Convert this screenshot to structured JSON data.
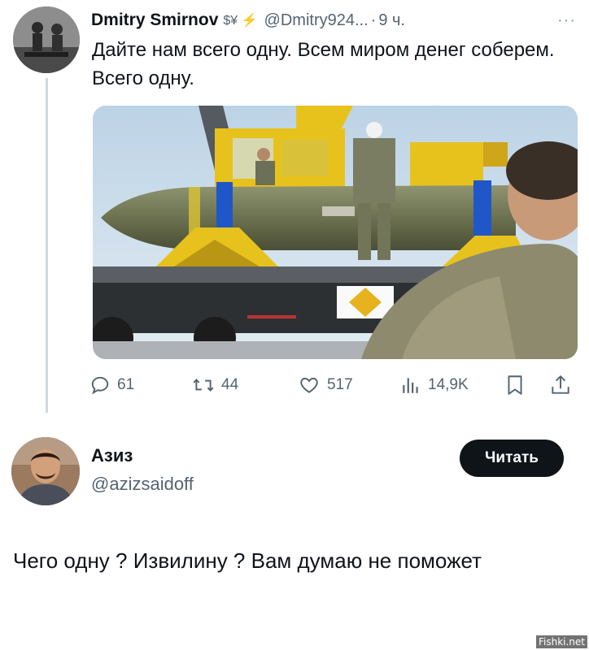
{
  "tweet": {
    "author_name": "Dmitry Smirnov",
    "author_badges": "$¥ ⚡",
    "handle": "@Dmitry924...",
    "separator": "·",
    "time": "9 ч.",
    "more": "···",
    "text": "Дайте нам всего одну. Всем миром денег соберем. Всего одну.",
    "media_icon": "photo",
    "stats": {
      "replies": "61",
      "retweets": "44",
      "likes": "517",
      "views": "14,9K"
    }
  },
  "reply_card": {
    "name": "Азиз",
    "handle": "@azizsaidoff",
    "follow_label": "Читать"
  },
  "reply_text": "Чего одну ? Извилину ? Вам думаю не поможет",
  "watermark": "Fishki.net",
  "colors": {
    "text": "#0f1419",
    "muted": "#536471",
    "line": "#cfd9de",
    "button_bg": "#0f1419"
  },
  "icons": [
    "reply-icon",
    "retweet-icon",
    "like-icon",
    "views-icon",
    "bookmark-icon",
    "share-icon",
    "more-icon",
    "bolt-icon"
  ]
}
